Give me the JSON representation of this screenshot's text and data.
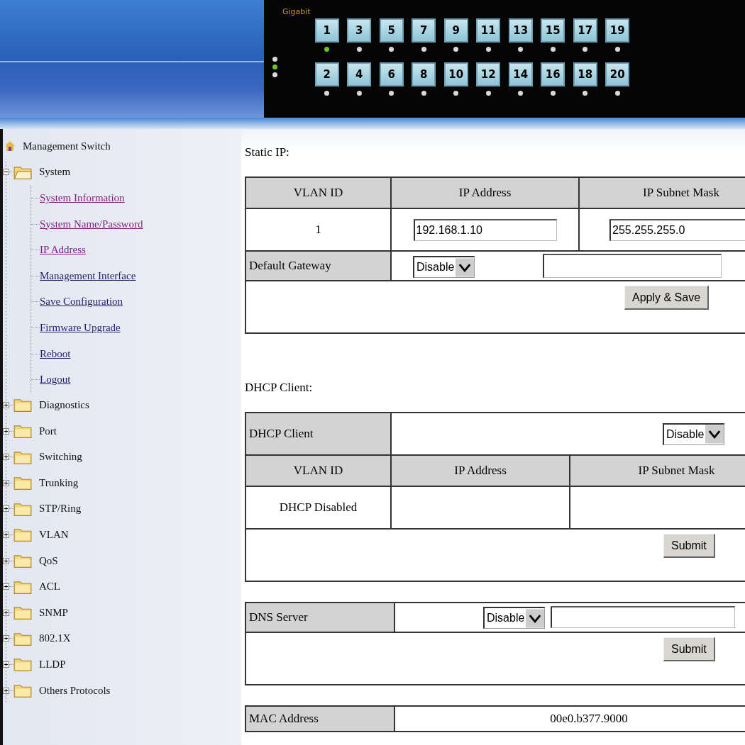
{
  "header": {
    "label": "Gigabit",
    "status_leds": [
      {
        "on": false
      },
      {
        "on": true
      },
      {
        "on": false
      }
    ],
    "ports": [
      {
        "number": "1",
        "link": true
      },
      {
        "number": "2",
        "link": false
      },
      {
        "number": "3",
        "link": false
      },
      {
        "number": "4",
        "link": false
      },
      {
        "number": "5",
        "link": false
      },
      {
        "number": "6",
        "link": false
      },
      {
        "number": "7",
        "link": false
      },
      {
        "number": "8",
        "link": false
      },
      {
        "number": "9",
        "link": false
      },
      {
        "number": "10",
        "link": false
      },
      {
        "number": "11",
        "link": false
      },
      {
        "number": "12",
        "link": false
      },
      {
        "number": "13",
        "link": false
      },
      {
        "number": "14",
        "link": false
      },
      {
        "number": "15",
        "link": false
      },
      {
        "number": "16",
        "link": false
      },
      {
        "number": "17",
        "link": false
      },
      {
        "number": "18",
        "link": false
      },
      {
        "number": "19",
        "link": false
      },
      {
        "number": "20",
        "link": false
      }
    ]
  },
  "sidebar": {
    "root": "Management Switch",
    "items": [
      {
        "label": "System",
        "expanded": true,
        "children": [
          {
            "label": "System Information",
            "visited": true
          },
          {
            "label": "System Name/Password",
            "visited": true
          },
          {
            "label": "IP Address",
            "visited": true
          },
          {
            "label": "Management Interface",
            "visited": false
          },
          {
            "label": "Save Configuration",
            "visited": false
          },
          {
            "label": "Firmware Upgrade",
            "visited": false
          },
          {
            "label": "Reboot",
            "visited": false
          },
          {
            "label": "Logout",
            "visited": false
          }
        ]
      },
      {
        "label": "Diagnostics",
        "expanded": false
      },
      {
        "label": "Port",
        "expanded": false
      },
      {
        "label": "Switching",
        "expanded": false
      },
      {
        "label": "Trunking",
        "expanded": false
      },
      {
        "label": "STP/Ring",
        "expanded": false
      },
      {
        "label": "VLAN",
        "expanded": false
      },
      {
        "label": "QoS",
        "expanded": false
      },
      {
        "label": "ACL",
        "expanded": false
      },
      {
        "label": "SNMP",
        "expanded": false
      },
      {
        "label": "802.1X",
        "expanded": false
      },
      {
        "label": "LLDP",
        "expanded": false
      },
      {
        "label": "Others Protocols",
        "expanded": false
      }
    ]
  },
  "static_ip": {
    "title": "Static IP:",
    "columns": [
      "VLAN ID",
      "IP Address",
      "IP Subnet Mask"
    ],
    "vlan_id": "1",
    "ip_address": "192.168.1.10",
    "subnet_mask": "255.255.255.0",
    "gateway_label": "Default Gateway",
    "gateway_mode": "Disable",
    "button": "Apply & Save"
  },
  "dhcp": {
    "title": "DHCP Client:",
    "label": "DHCP Client",
    "mode": "Disable",
    "columns": [
      "VLAN ID",
      "IP Address",
      "IP Subnet Mask"
    ],
    "status": "DHCP Disabled",
    "button": "Submit"
  },
  "dns": {
    "label": "DNS Server",
    "mode": "Disable",
    "button": "Submit"
  },
  "mac": {
    "label": "MAC Address",
    "value": "00e0.b377.9000"
  }
}
